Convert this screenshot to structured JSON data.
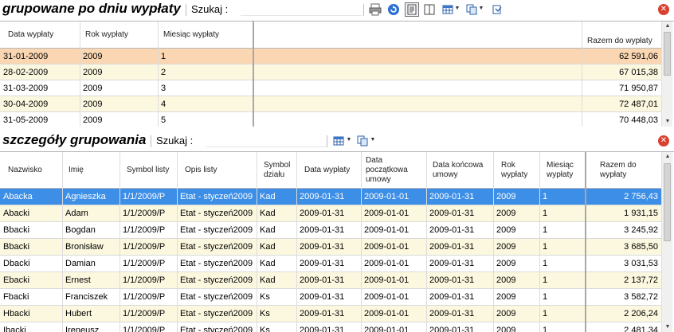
{
  "top": {
    "title": "grupowane po dniu wypłaty",
    "search_label": "Szukaj  :",
    "search_value": "",
    "columns": [
      "Data wypłaty",
      "Rok wypłaty",
      "Miesiąc wypłaty",
      "",
      "Razem do wypłaty"
    ],
    "rows": [
      [
        "31-01-2009",
        "2009",
        "1",
        "",
        "62 591,06"
      ],
      [
        "28-02-2009",
        "2009",
        "2",
        "",
        "67 015,38"
      ],
      [
        "31-03-2009",
        "2009",
        "3",
        "",
        "71 950,87"
      ],
      [
        "30-04-2009",
        "2009",
        "4",
        "",
        "72 487,01"
      ],
      [
        "31-05-2009",
        "2009",
        "5",
        "",
        "70 448,03"
      ]
    ],
    "selected_row": 0,
    "icons": [
      "printer-icon",
      "refresh-icon",
      "report-icon",
      "columns-icon",
      "grid-layout-icon",
      "copy-icon",
      "export-icon"
    ]
  },
  "bottom": {
    "title": "szczegóły grupowania",
    "search_label": "Szukaj  :",
    "search_value": "",
    "columns": [
      "Nazwisko",
      "Imię",
      "Symbol listy",
      "Opis listy",
      "Symbol działu",
      "Data wypłaty",
      "Data początkowa umowy",
      "Data końcowa umowy",
      "Rok wypłaty",
      "Miesiąc wypłaty",
      "Razem do wypłaty"
    ],
    "rows": [
      [
        "Abacka",
        "Agnieszka",
        "1/1/2009/P",
        "Etat - styczeń2009",
        "Kad",
        "2009-01-31",
        "2009-01-01",
        "2009-01-31",
        "2009",
        "1",
        "2 756,43"
      ],
      [
        "Abacki",
        "Adam",
        "1/1/2009/P",
        "Etat - styczeń2009",
        "Kad",
        "2009-01-31",
        "2009-01-01",
        "2009-01-31",
        "2009",
        "1",
        "1 931,15"
      ],
      [
        "Bbacki",
        "Bogdan",
        "1/1/2009/P",
        "Etat - styczeń2009",
        "Kad",
        "2009-01-31",
        "2009-01-01",
        "2009-01-31",
        "2009",
        "1",
        "3 245,92"
      ],
      [
        "Bbacki",
        "Bronisław",
        "1/1/2009/P",
        "Etat - styczeń2009",
        "Kad",
        "2009-01-31",
        "2009-01-01",
        "2009-01-31",
        "2009",
        "1",
        "3 685,50"
      ],
      [
        "Dbacki",
        "Damian",
        "1/1/2009/P",
        "Etat - styczeń2009",
        "Kad",
        "2009-01-31",
        "2009-01-01",
        "2009-01-31",
        "2009",
        "1",
        "3 031,53"
      ],
      [
        "Ebacki",
        "Ernest",
        "1/1/2009/P",
        "Etat - styczeń2009",
        "Kad",
        "2009-01-31",
        "2009-01-01",
        "2009-01-31",
        "2009",
        "1",
        "2 137,72"
      ],
      [
        "Fbacki",
        "Franciszek",
        "1/1/2009/P",
        "Etat - styczeń2009",
        "Ks",
        "2009-01-31",
        "2009-01-01",
        "2009-01-31",
        "2009",
        "1",
        "3 582,72"
      ],
      [
        "Hbacki",
        "Hubert",
        "1/1/2009/P",
        "Etat - styczeń2009",
        "Ks",
        "2009-01-31",
        "2009-01-01",
        "2009-01-31",
        "2009",
        "1",
        "2 206,24"
      ],
      [
        "Ibacki",
        "Ireneusz",
        "1/1/2009/P",
        "Etat - styczeń2009",
        "Ks",
        "2009-01-31",
        "2009-01-01",
        "2009-01-31",
        "2009",
        "1",
        "2 481,34"
      ]
    ],
    "selected_row": 0,
    "icons": [
      "grid-layout-icon",
      "copy-icon"
    ]
  },
  "colors": {
    "selected_top": "#fad6b3",
    "selected_bottom": "#3d8ee6",
    "alt_row": "#fcf8df",
    "row": "#ffffff"
  }
}
